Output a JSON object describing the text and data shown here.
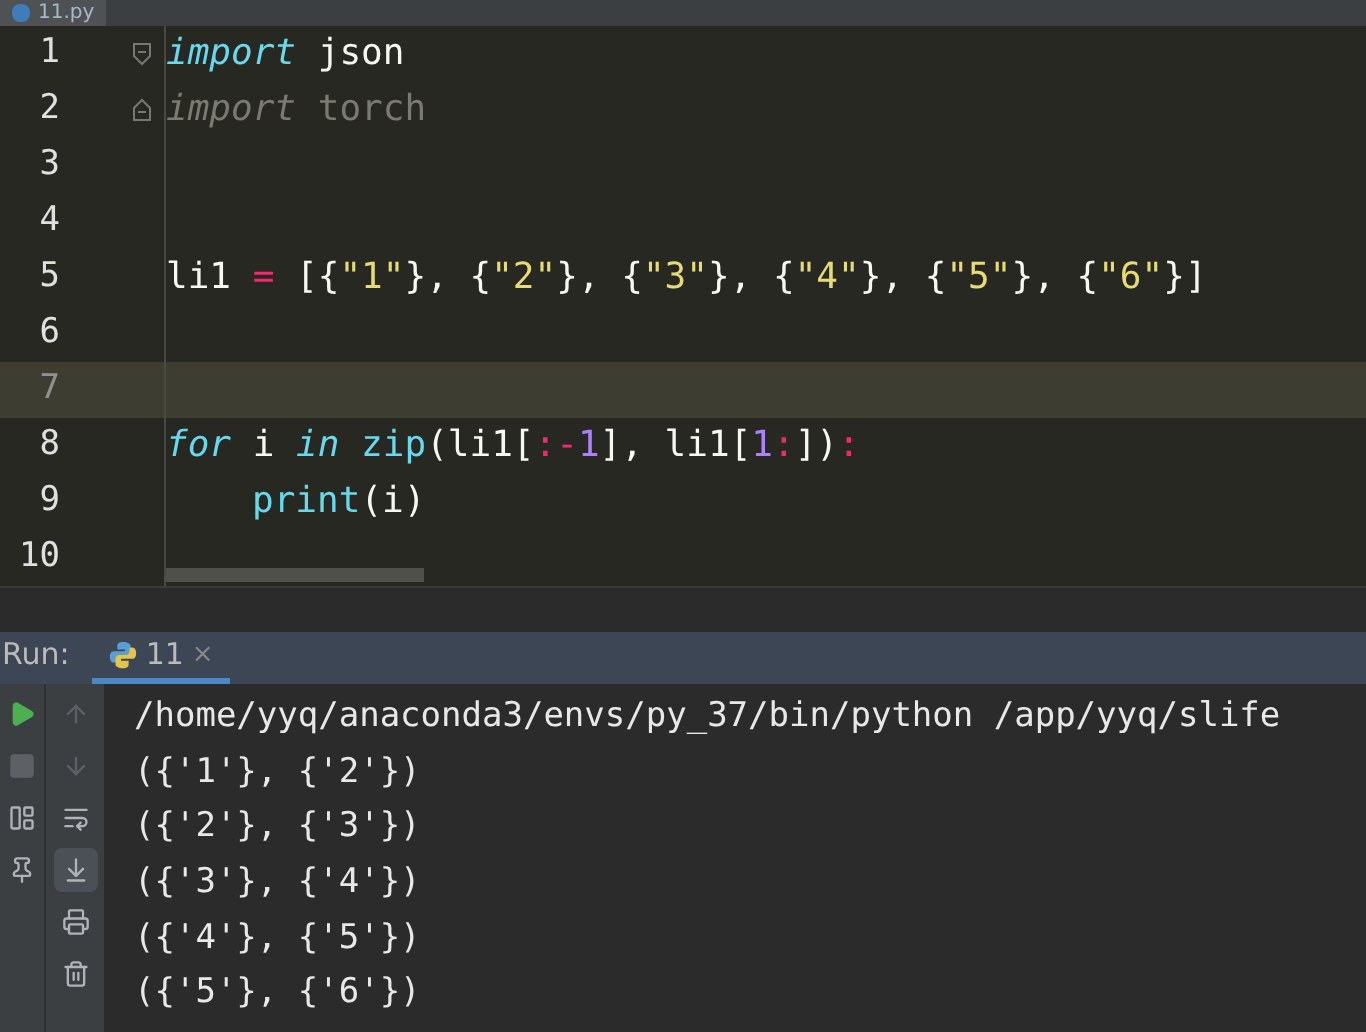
{
  "editor_tab": {
    "label": "11.py"
  },
  "code_lines": [
    {
      "number": "1",
      "current": false,
      "fold_start": true,
      "tokens": [
        {
          "kind": "keyword",
          "text": "import"
        },
        {
          "kind": "plain",
          "text": " json"
        }
      ]
    },
    {
      "number": "2",
      "current": false,
      "fold_end": true,
      "tokens": [
        {
          "kind": "keyword-unused",
          "text": "import"
        },
        {
          "kind": "unused",
          "text": " torch"
        }
      ]
    },
    {
      "number": "3",
      "current": false
    },
    {
      "number": "4",
      "current": false
    },
    {
      "number": "5",
      "current": false,
      "tokens": [
        {
          "kind": "plain",
          "text": "li1 "
        },
        {
          "kind": "operator",
          "text": "="
        },
        {
          "kind": "plain",
          "text": " [{"
        },
        {
          "kind": "string",
          "text": "\"1\""
        },
        {
          "kind": "plain",
          "text": "}, {"
        },
        {
          "kind": "string",
          "text": "\"2\""
        },
        {
          "kind": "plain",
          "text": "}, {"
        },
        {
          "kind": "string",
          "text": "\"3\""
        },
        {
          "kind": "plain",
          "text": "}, {"
        },
        {
          "kind": "string",
          "text": "\"4\""
        },
        {
          "kind": "plain",
          "text": "}, {"
        },
        {
          "kind": "string",
          "text": "\"5\""
        },
        {
          "kind": "plain",
          "text": "}, {"
        },
        {
          "kind": "string",
          "text": "\"6\""
        },
        {
          "kind": "plain",
          "text": "}]"
        }
      ]
    },
    {
      "number": "6",
      "current": false
    },
    {
      "number": "7",
      "current": true
    },
    {
      "number": "8",
      "current": false,
      "tokens": [
        {
          "kind": "keyword",
          "text": "for"
        },
        {
          "kind": "plain",
          "text": " i "
        },
        {
          "kind": "keyword",
          "text": "in"
        },
        {
          "kind": "builtin",
          "text": " zip"
        },
        {
          "kind": "plain",
          "text": "(li1["
        },
        {
          "kind": "operator",
          "text": ":-"
        },
        {
          "kind": "number",
          "text": "1"
        },
        {
          "kind": "plain",
          "text": "], li1["
        },
        {
          "kind": "number",
          "text": "1"
        },
        {
          "kind": "operator",
          "text": ":"
        },
        {
          "kind": "plain",
          "text": "])"
        },
        {
          "kind": "operator",
          "text": ":"
        }
      ]
    },
    {
      "number": "9",
      "current": false,
      "indented": true,
      "tokens": [
        {
          "kind": "builtin",
          "text": "print"
        },
        {
          "kind": "plain",
          "text": "(i)"
        }
      ]
    },
    {
      "number": "10",
      "current": false
    }
  ],
  "run_panel": {
    "label": "Run:",
    "tab": {
      "label": "11",
      "selected": true,
      "close": "×"
    },
    "left_toolbar": [
      {
        "kind": "run",
        "disabled": false
      },
      {
        "kind": "stop",
        "disabled": true
      },
      {
        "kind": "layout",
        "disabled": false
      },
      {
        "kind": "pin",
        "disabled": false
      }
    ],
    "right_toolbar": [
      {
        "kind": "up",
        "disabled": true,
        "selected": false
      },
      {
        "kind": "down",
        "disabled": true,
        "selected": false
      },
      {
        "kind": "wrap",
        "disabled": false,
        "selected": false
      },
      {
        "kind": "scroll-end",
        "disabled": false,
        "selected": true
      },
      {
        "kind": "print",
        "disabled": false,
        "selected": false
      },
      {
        "kind": "delete",
        "disabled": false,
        "selected": false
      }
    ],
    "output": [
      "/home/yyq/anaconda3/envs/py_37/bin/python /app/yyq/slife",
      "({'1'}, {'2'})",
      "({'2'}, {'3'})",
      "({'3'}, {'4'})",
      "({'4'}, {'5'})",
      "({'5'}, {'6'})"
    ]
  }
}
